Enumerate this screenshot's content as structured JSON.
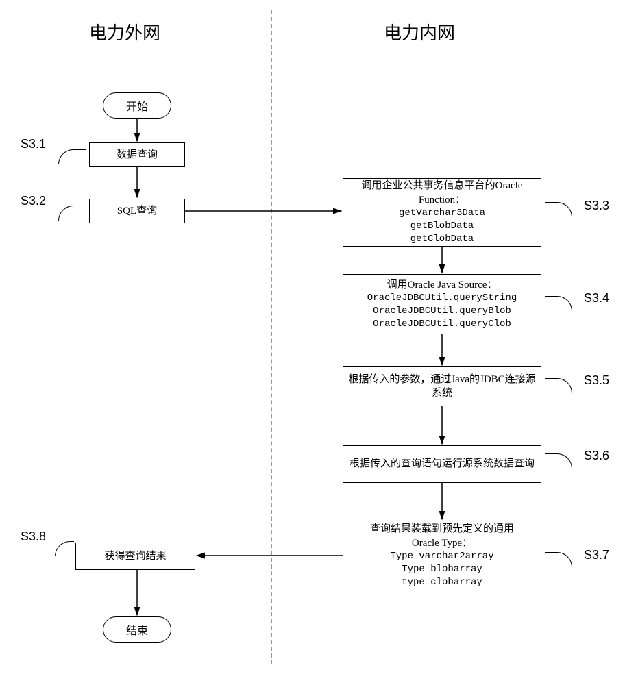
{
  "headers": {
    "left": "电力外网",
    "right": "电力内网"
  },
  "terminators": {
    "start": "开始",
    "end": "结束"
  },
  "steps": {
    "s31": {
      "label": "S3.1",
      "text": "数据查询"
    },
    "s32": {
      "label": "S3.2",
      "text": "SQL查询"
    },
    "s33": {
      "label": "S3.3",
      "title1": "调用企业公共事务信息平台的Oracle",
      "title2": "Function：",
      "lines": [
        "getVarchar3Data",
        "getBlobData",
        "getClobData"
      ]
    },
    "s34": {
      "label": "S3.4",
      "title": "调用Oracle Java Source：",
      "lines": [
        "OracleJDBCUtil.queryString",
        "OracleJDBCUtil.queryBlob",
        "OracleJDBCUtil.queryClob"
      ]
    },
    "s35": {
      "label": "S3.5",
      "text": "根据传入的参数，通过Java的JDBC连接源系统"
    },
    "s36": {
      "label": "S3.6",
      "text": "根据传入的查询语句运行源系统数据查询"
    },
    "s37": {
      "label": "S3.7",
      "title1": "查询结果装载到预先定义的通用",
      "title2": "Oracle Type：",
      "lines": [
        "Type varchar2array",
        "Type blobarray",
        "type clobarray"
      ]
    },
    "s38": {
      "label": "S3.8",
      "text": "获得查询结果"
    }
  }
}
